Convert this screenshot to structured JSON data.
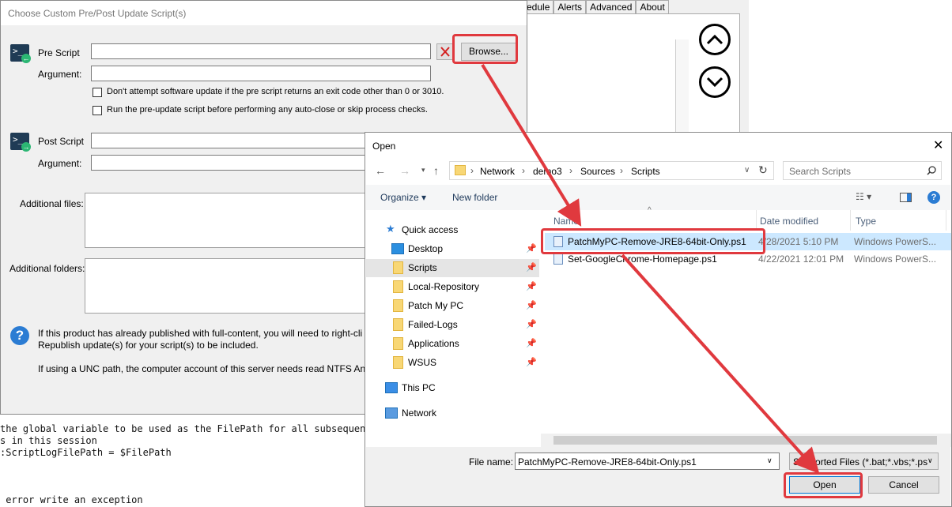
{
  "background": {
    "tabs": [
      "edule",
      "Alerts",
      "Advanced",
      "About"
    ],
    "code_lines": [
      "the global variable to be used as the FilePath for all subsequent",
      "s in this session",
      ":ScriptLogFilePath = $FilePath",
      "",
      " error write an exception"
    ]
  },
  "script_dialog": {
    "title": "Choose Custom Pre/Post Update Script(s)",
    "pre_script_label": "Pre Script",
    "argument_label": "Argument:",
    "browse_label": "Browse...",
    "check1": "Don't attempt software update if the pre script returns an exit code other than 0 or 3010.",
    "check2": "Run the pre-update script before performing any auto-close or skip process checks.",
    "post_script_label": "Post Script",
    "post_argument_label": "Argument:",
    "additional_files_label": "Additional files:",
    "additional_folders_label": "Additional folders:",
    "info_line1": "If this product has already published with full-content, you will need to right-cli",
    "info_line2": "Republish update(s) for your script(s) to be included.",
    "info_line3": "If using a UNC path, the computer account of this server needs read NTFS An"
  },
  "open_dialog": {
    "title": "Open",
    "breadcrumb": [
      "Network",
      "demo3",
      "Sources",
      "Scripts"
    ],
    "search_placeholder": "Search Scripts",
    "organize_label": "Organize",
    "new_folder_label": "New folder",
    "nav": {
      "quick_access": "Quick access",
      "items": [
        "Desktop",
        "Scripts",
        "Local-Repository",
        "Patch My PC",
        "Failed-Logs",
        "Applications",
        "WSUS"
      ],
      "this_pc": "This PC",
      "network": "Network"
    },
    "columns": {
      "name": "Name",
      "date": "Date modified",
      "type": "Type"
    },
    "files": [
      {
        "name": "PatchMyPC-Remove-JRE8-64bit-Only.ps1",
        "date": "4/28/2021 5:10 PM",
        "type": "Windows PowerS..."
      },
      {
        "name": "Set-GoogleChrome-Homepage.ps1",
        "date": "4/22/2021 12:01 PM",
        "type": "Windows PowerS..."
      }
    ],
    "file_name_label": "File name:",
    "file_name_value": "PatchMyPC-Remove-JRE8-64bit-Only.ps1",
    "filter_value": "Supported Files (*.bat;*.vbs;*.ps",
    "open_label": "Open",
    "cancel_label": "Cancel"
  },
  "colors": {
    "highlight": "#e0393e",
    "selection": "#cce8ff"
  }
}
